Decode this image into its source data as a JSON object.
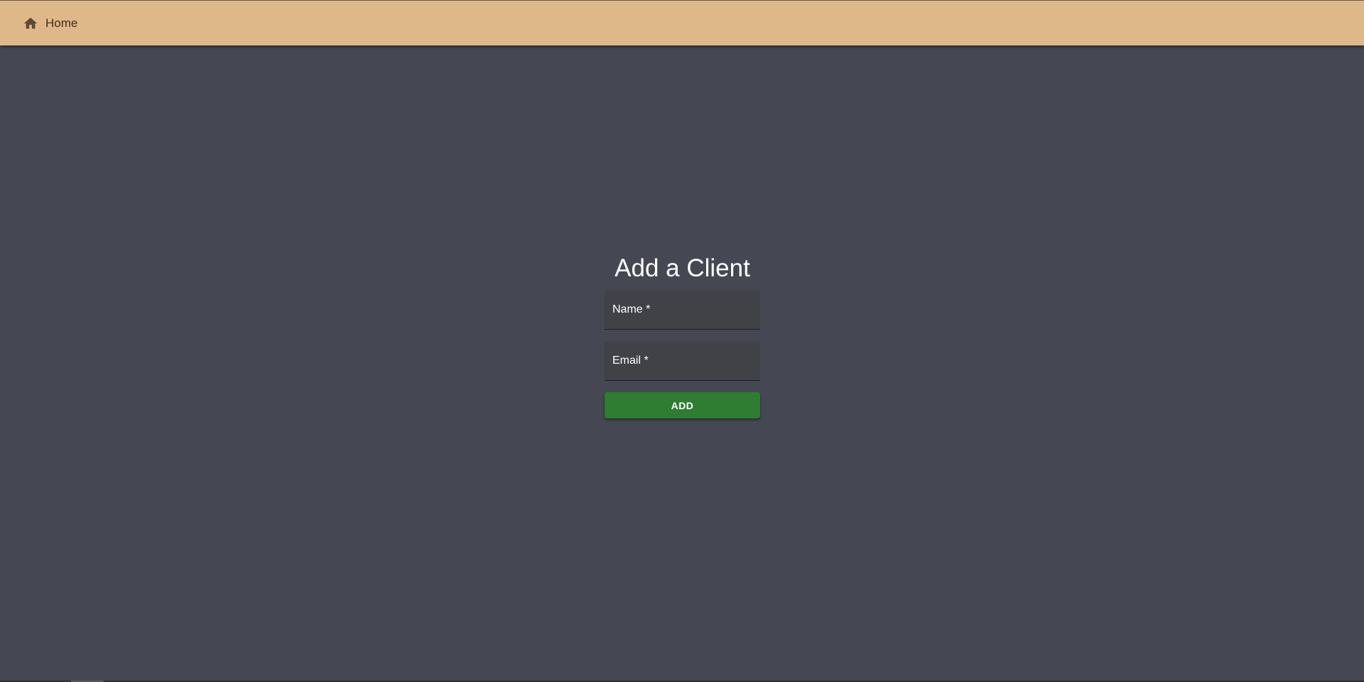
{
  "nav": {
    "home_label": "Home",
    "home_icon": "home-icon"
  },
  "form": {
    "title": "Add a Client",
    "name_label": "Name *",
    "email_label": "Email *",
    "name_value": "",
    "email_value": "",
    "submit_label": "ADD"
  },
  "colors": {
    "topbar": "#dfb88a",
    "background": "#454852",
    "field_background": "#404247",
    "submit_button": "#2e7d32"
  }
}
